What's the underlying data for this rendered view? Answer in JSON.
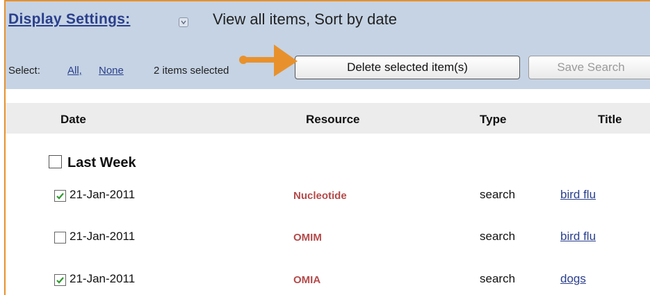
{
  "header": {
    "display_settings_label": "Display Settings:",
    "view_summary": "View all items, Sort by date",
    "select_label": "Select:",
    "select_all": "All,",
    "select_none": "None",
    "selected_count": "2 items selected",
    "delete_button": "Delete selected item(s)",
    "save_search_button": "Save Search"
  },
  "columns": {
    "date": "Date",
    "resource": "Resource",
    "type": "Type",
    "title": "Title"
  },
  "group": {
    "label": "Last Week",
    "checked": false
  },
  "rows": [
    {
      "checked": true,
      "date": "21-Jan-2011",
      "resource": "Nucleotide",
      "type": "search",
      "title": "bird flu"
    },
    {
      "checked": false,
      "date": "21-Jan-2011",
      "resource": "OMIM",
      "type": "search",
      "title": "bird flu"
    },
    {
      "checked": true,
      "date": "21-Jan-2011",
      "resource": "OMIA",
      "type": "search",
      "title": "dogs"
    }
  ],
  "colors": {
    "frame_orange": "#e8912c",
    "header_blue": "#c5d3e4",
    "link_blue": "#2a3f8c",
    "resource_red": "#b44a4a",
    "check_green": "#2e9a2e"
  }
}
